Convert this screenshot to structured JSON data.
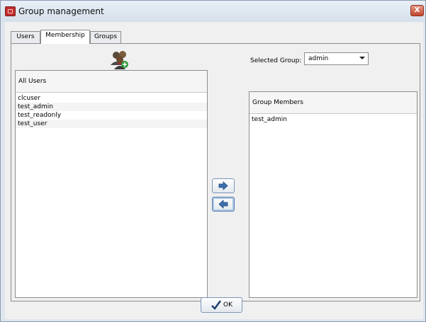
{
  "window": {
    "title": "Group management",
    "close_label": "X"
  },
  "tabs": [
    {
      "label": "Users",
      "active": false
    },
    {
      "label": "Membership",
      "active": true
    },
    {
      "label": "Groups",
      "active": false
    }
  ],
  "selected_group": {
    "label": "Selected Group:",
    "value": "admin"
  },
  "all_users": {
    "header": "All Users",
    "items": [
      "clcuser",
      "test_admin",
      "test_readonly",
      "test_user"
    ]
  },
  "group_members": {
    "header": "Group Members",
    "items": [
      "test_admin"
    ]
  },
  "ok_button": {
    "label": "OK"
  },
  "icons": {
    "app": "group-app-icon",
    "group_users": "users-group-icon",
    "add": "arrow-right-icon",
    "remove": "arrow-left-icon",
    "ok": "checkmark-icon"
  },
  "colors": {
    "accent": "#c32e2e",
    "close": "#c2452b",
    "arrow": "#3c6fb0"
  }
}
